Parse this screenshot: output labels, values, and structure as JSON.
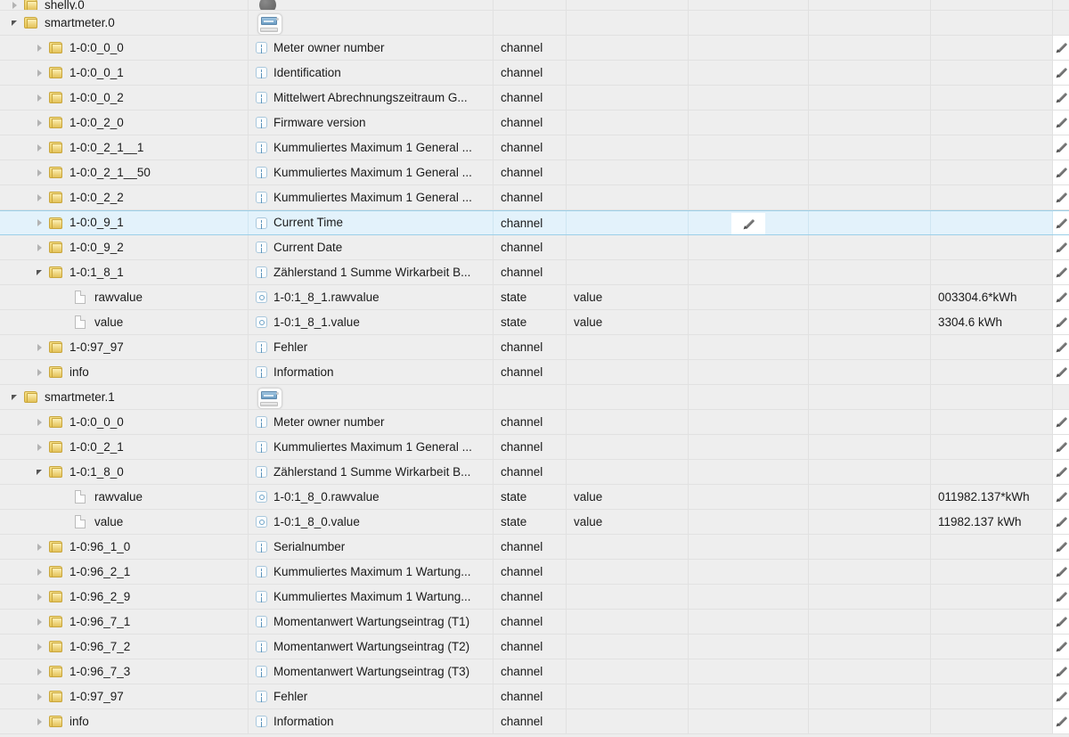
{
  "app": {
    "view": "object-tree",
    "colors": {
      "background": "#eeeeee",
      "row_border": "#e1e1e1",
      "selected_row": "#e3f2fb",
      "selected_border": "#9ccfe8",
      "folder": "#e8c554",
      "badge_border": "#a9c8dd"
    }
  },
  "icons": {
    "expanded": "triangle-down-icon",
    "collapsed": "triangle-right-icon",
    "folder": "folder-icon",
    "document": "document-icon",
    "channel_badge": "channel-icon",
    "state_badge": "state-icon",
    "device": "smartmeter-device-icon",
    "device_dark": "shelly-device-icon",
    "edit": "pencil-icon"
  },
  "rows": [
    {
      "id": "shelly.0",
      "indent": 0,
      "twisty": "collapsed",
      "node_icon": "folder",
      "name": "shelly.0",
      "badge": null,
      "desc": "",
      "device_icon": "dark",
      "role": "",
      "type": "",
      "room": "",
      "func": "",
      "value": "",
      "edit": false,
      "partial": true,
      "selected": false
    },
    {
      "id": "smartmeter.0",
      "indent": 0,
      "twisty": "expanded",
      "node_icon": "folder",
      "name": "smartmeter.0",
      "badge": null,
      "desc": "",
      "device_icon": "meter",
      "role": "",
      "type": "",
      "room": "",
      "func": "",
      "value": "",
      "edit": false,
      "partial": false,
      "selected": false
    },
    {
      "id": "sm0-1-0:0_0_0",
      "indent": 1,
      "twisty": "collapsed",
      "node_icon": "folder",
      "name": "1-0:0_0_0",
      "badge": "channel",
      "desc": "Meter owner number",
      "device_icon": null,
      "role": "channel",
      "type": "",
      "room": "",
      "func": "",
      "value": "",
      "edit": true,
      "partial": false,
      "selected": false
    },
    {
      "id": "sm0-1-0:0_0_1",
      "indent": 1,
      "twisty": "collapsed",
      "node_icon": "folder",
      "name": "1-0:0_0_1",
      "badge": "channel",
      "desc": "Identification",
      "device_icon": null,
      "role": "channel",
      "type": "",
      "room": "",
      "func": "",
      "value": "",
      "edit": true,
      "partial": false,
      "selected": false
    },
    {
      "id": "sm0-1-0:0_0_2",
      "indent": 1,
      "twisty": "collapsed",
      "node_icon": "folder",
      "name": "1-0:0_0_2",
      "badge": "channel",
      "desc": "Mittelwert Abrechnungszeitraum G...",
      "device_icon": null,
      "role": "channel",
      "type": "",
      "room": "",
      "func": "",
      "value": "",
      "edit": true,
      "partial": false,
      "selected": false
    },
    {
      "id": "sm0-1-0:0_2_0",
      "indent": 1,
      "twisty": "collapsed",
      "node_icon": "folder",
      "name": "1-0:0_2_0",
      "badge": "channel",
      "desc": "Firmware version",
      "device_icon": null,
      "role": "channel",
      "type": "",
      "room": "",
      "func": "",
      "value": "",
      "edit": true,
      "partial": false,
      "selected": false
    },
    {
      "id": "sm0-1-0:0_2_1__1",
      "indent": 1,
      "twisty": "collapsed",
      "node_icon": "folder",
      "name": "1-0:0_2_1__1",
      "badge": "channel",
      "desc": "Kummuliertes Maximum 1 General ...",
      "device_icon": null,
      "role": "channel",
      "type": "",
      "room": "",
      "func": "",
      "value": "",
      "edit": true,
      "partial": false,
      "selected": false
    },
    {
      "id": "sm0-1-0:0_2_1__50",
      "indent": 1,
      "twisty": "collapsed",
      "node_icon": "folder",
      "name": "1-0:0_2_1__50",
      "badge": "channel",
      "desc": "Kummuliertes Maximum 1 General ...",
      "device_icon": null,
      "role": "channel",
      "type": "",
      "room": "",
      "func": "",
      "value": "",
      "edit": true,
      "partial": false,
      "selected": false
    },
    {
      "id": "sm0-1-0:0_2_2",
      "indent": 1,
      "twisty": "collapsed",
      "node_icon": "folder",
      "name": "1-0:0_2_2",
      "badge": "channel",
      "desc": "Kummuliertes Maximum 1 General ...",
      "device_icon": null,
      "role": "channel",
      "type": "",
      "room": "",
      "func": "",
      "value": "",
      "edit": true,
      "partial": false,
      "selected": false
    },
    {
      "id": "sm0-1-0:0_9_1",
      "indent": 1,
      "twisty": "collapsed",
      "node_icon": "folder",
      "name": "1-0:0_9_1",
      "badge": "channel",
      "desc": "Current Time",
      "device_icon": null,
      "role": "channel",
      "type": "",
      "room": "",
      "func": "",
      "value": "",
      "edit": true,
      "mid_edit": true,
      "partial": false,
      "selected": true
    },
    {
      "id": "sm0-1-0:0_9_2",
      "indent": 1,
      "twisty": "collapsed",
      "node_icon": "folder",
      "name": "1-0:0_9_2",
      "badge": "channel",
      "desc": "Current Date",
      "device_icon": null,
      "role": "channel",
      "type": "",
      "room": "",
      "func": "",
      "value": "",
      "edit": true,
      "partial": false,
      "selected": false
    },
    {
      "id": "sm0-1-0:1_8_1",
      "indent": 1,
      "twisty": "expanded",
      "node_icon": "folder",
      "name": "1-0:1_8_1",
      "badge": "channel",
      "desc": "Zählerstand 1 Summe Wirkarbeit B...",
      "device_icon": null,
      "role": "channel",
      "type": "",
      "room": "",
      "func": "",
      "value": "",
      "edit": true,
      "partial": false,
      "selected": false
    },
    {
      "id": "sm0-1-0:1_8_1.rawvalue",
      "indent": 2,
      "twisty": "none",
      "node_icon": "document",
      "name": "rawvalue",
      "badge": "state",
      "desc": "1-0:1_8_1.rawvalue",
      "device_icon": null,
      "role": "state",
      "type": "value",
      "room": "",
      "func": "",
      "value": "003304.6*kWh",
      "edit": true,
      "partial": false,
      "selected": false
    },
    {
      "id": "sm0-1-0:1_8_1.value",
      "indent": 2,
      "twisty": "none",
      "node_icon": "document",
      "name": "value",
      "badge": "state",
      "desc": "1-0:1_8_1.value",
      "device_icon": null,
      "role": "state",
      "type": "value",
      "room": "",
      "func": "",
      "value": "3304.6 kWh",
      "edit": true,
      "partial": false,
      "selected": false
    },
    {
      "id": "sm0-1-0:97_97",
      "indent": 1,
      "twisty": "collapsed",
      "node_icon": "folder",
      "name": "1-0:97_97",
      "badge": "channel",
      "desc": "Fehler",
      "device_icon": null,
      "role": "channel",
      "type": "",
      "room": "",
      "func": "",
      "value": "",
      "edit": true,
      "partial": false,
      "selected": false
    },
    {
      "id": "sm0-info",
      "indent": 1,
      "twisty": "collapsed",
      "node_icon": "folder",
      "name": "info",
      "badge": "channel",
      "desc": "Information",
      "device_icon": null,
      "role": "channel",
      "type": "",
      "room": "",
      "func": "",
      "value": "",
      "edit": true,
      "partial": false,
      "selected": false
    },
    {
      "id": "smartmeter.1",
      "indent": 0,
      "twisty": "expanded",
      "node_icon": "folder",
      "name": "smartmeter.1",
      "badge": null,
      "desc": "",
      "device_icon": "meter",
      "role": "",
      "type": "",
      "room": "",
      "func": "",
      "value": "",
      "edit": false,
      "partial": false,
      "selected": false
    },
    {
      "id": "sm1-1-0:0_0_0",
      "indent": 1,
      "twisty": "collapsed",
      "node_icon": "folder",
      "name": "1-0:0_0_0",
      "badge": "channel",
      "desc": "Meter owner number",
      "device_icon": null,
      "role": "channel",
      "type": "",
      "room": "",
      "func": "",
      "value": "",
      "edit": true,
      "partial": false,
      "selected": false
    },
    {
      "id": "sm1-1-0:0_2_1",
      "indent": 1,
      "twisty": "collapsed",
      "node_icon": "folder",
      "name": "1-0:0_2_1",
      "badge": "channel",
      "desc": "Kummuliertes Maximum 1 General ...",
      "device_icon": null,
      "role": "channel",
      "type": "",
      "room": "",
      "func": "",
      "value": "",
      "edit": true,
      "partial": false,
      "selected": false
    },
    {
      "id": "sm1-1-0:1_8_0",
      "indent": 1,
      "twisty": "expanded",
      "node_icon": "folder",
      "name": "1-0:1_8_0",
      "badge": "channel",
      "desc": "Zählerstand 1 Summe Wirkarbeit B...",
      "device_icon": null,
      "role": "channel",
      "type": "",
      "room": "",
      "func": "",
      "value": "",
      "edit": true,
      "partial": false,
      "selected": false
    },
    {
      "id": "sm1-1-0:1_8_0.rawvalue",
      "indent": 2,
      "twisty": "none",
      "node_icon": "document",
      "name": "rawvalue",
      "badge": "state",
      "desc": "1-0:1_8_0.rawvalue",
      "device_icon": null,
      "role": "state",
      "type": "value",
      "room": "",
      "func": "",
      "value": "011982.137*kWh",
      "edit": true,
      "partial": false,
      "selected": false
    },
    {
      "id": "sm1-1-0:1_8_0.value",
      "indent": 2,
      "twisty": "none",
      "node_icon": "document",
      "name": "value",
      "badge": "state",
      "desc": "1-0:1_8_0.value",
      "device_icon": null,
      "role": "state",
      "type": "value",
      "room": "",
      "func": "",
      "value": "11982.137 kWh",
      "edit": true,
      "partial": false,
      "selected": false
    },
    {
      "id": "sm1-1-0:96_1_0",
      "indent": 1,
      "twisty": "collapsed",
      "node_icon": "folder",
      "name": "1-0:96_1_0",
      "badge": "channel",
      "desc": "Serialnumber",
      "device_icon": null,
      "role": "channel",
      "type": "",
      "room": "",
      "func": "",
      "value": "",
      "edit": true,
      "partial": false,
      "selected": false
    },
    {
      "id": "sm1-1-0:96_2_1",
      "indent": 1,
      "twisty": "collapsed",
      "node_icon": "folder",
      "name": "1-0:96_2_1",
      "badge": "channel",
      "desc": "Kummuliertes Maximum 1 Wartung...",
      "device_icon": null,
      "role": "channel",
      "type": "",
      "room": "",
      "func": "",
      "value": "",
      "edit": true,
      "partial": false,
      "selected": false
    },
    {
      "id": "sm1-1-0:96_2_9",
      "indent": 1,
      "twisty": "collapsed",
      "node_icon": "folder",
      "name": "1-0:96_2_9",
      "badge": "channel",
      "desc": "Kummuliertes Maximum 1 Wartung...",
      "device_icon": null,
      "role": "channel",
      "type": "",
      "room": "",
      "func": "",
      "value": "",
      "edit": true,
      "partial": false,
      "selected": false
    },
    {
      "id": "sm1-1-0:96_7_1",
      "indent": 1,
      "twisty": "collapsed",
      "node_icon": "folder",
      "name": "1-0:96_7_1",
      "badge": "channel",
      "desc": "Momentanwert Wartungseintrag (T1)",
      "device_icon": null,
      "role": "channel",
      "type": "",
      "room": "",
      "func": "",
      "value": "",
      "edit": true,
      "partial": false,
      "selected": false
    },
    {
      "id": "sm1-1-0:96_7_2",
      "indent": 1,
      "twisty": "collapsed",
      "node_icon": "folder",
      "name": "1-0:96_7_2",
      "badge": "channel",
      "desc": "Momentanwert Wartungseintrag (T2)",
      "device_icon": null,
      "role": "channel",
      "type": "",
      "room": "",
      "func": "",
      "value": "",
      "edit": true,
      "partial": false,
      "selected": false
    },
    {
      "id": "sm1-1-0:96_7_3",
      "indent": 1,
      "twisty": "collapsed",
      "node_icon": "folder",
      "name": "1-0:96_7_3",
      "badge": "channel",
      "desc": "Momentanwert Wartungseintrag (T3)",
      "device_icon": null,
      "role": "channel",
      "type": "",
      "room": "",
      "func": "",
      "value": "",
      "edit": true,
      "partial": false,
      "selected": false
    },
    {
      "id": "sm1-1-0:97_97",
      "indent": 1,
      "twisty": "collapsed",
      "node_icon": "folder",
      "name": "1-0:97_97",
      "badge": "channel",
      "desc": "Fehler",
      "device_icon": null,
      "role": "channel",
      "type": "",
      "room": "",
      "func": "",
      "value": "",
      "edit": true,
      "partial": false,
      "selected": false
    },
    {
      "id": "sm1-info",
      "indent": 1,
      "twisty": "collapsed",
      "node_icon": "folder",
      "name": "info",
      "badge": "channel",
      "desc": "Information",
      "device_icon": null,
      "role": "channel",
      "type": "",
      "room": "",
      "func": "",
      "value": "",
      "edit": true,
      "partial": false,
      "selected": false
    }
  ]
}
